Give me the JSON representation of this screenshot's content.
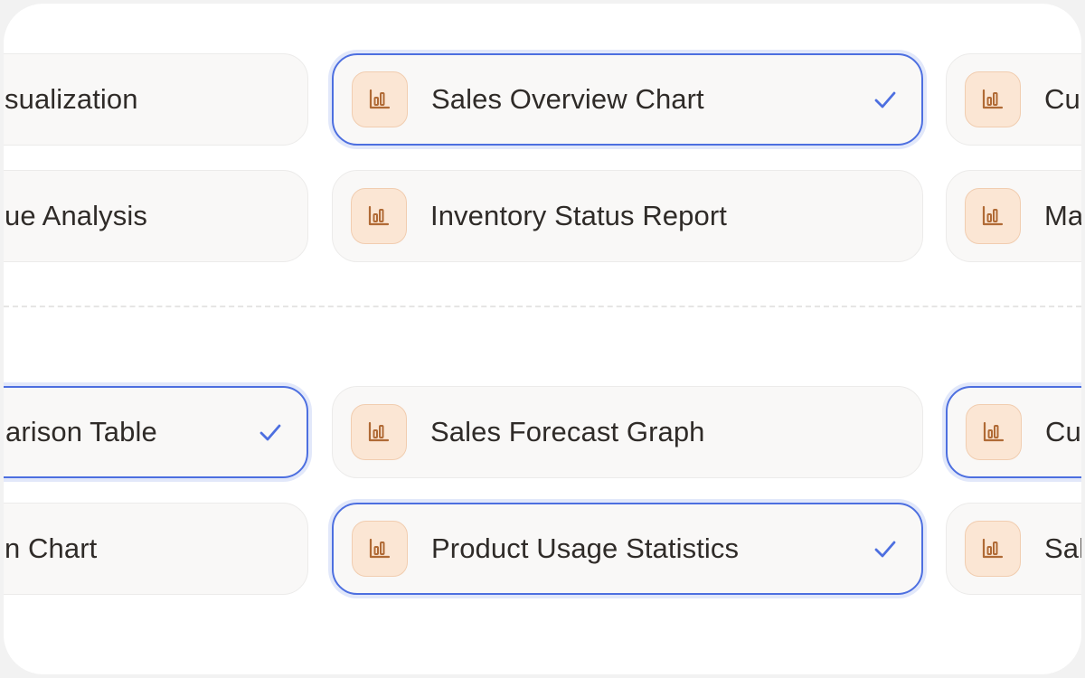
{
  "colors": {
    "accent": "#4d6fe0",
    "icon_bg": "#fbe6d4",
    "icon_stroke": "#b06a35",
    "card_bg": "#f9f8f7",
    "text": "#2f2b28"
  },
  "group1": {
    "row1": {
      "left": {
        "label": "sualization",
        "selected": false
      },
      "middle": {
        "label": "Sales Overview Chart",
        "icon": "bar-chart-icon",
        "selected": true
      },
      "right": {
        "label": "Cu",
        "icon": "bar-chart-icon",
        "selected": false
      }
    },
    "row2": {
      "left": {
        "label": "ue Analysis",
        "selected": false
      },
      "middle": {
        "label": "Inventory Status Report",
        "icon": "bar-chart-icon",
        "selected": false
      },
      "right": {
        "label": "Ma",
        "icon": "bar-chart-icon",
        "selected": false
      }
    }
  },
  "group2": {
    "row1": {
      "left": {
        "label": "arison Table",
        "selected": true
      },
      "middle": {
        "label": "Sales Forecast Graph",
        "icon": "bar-chart-icon",
        "selected": false
      },
      "right": {
        "label": "Cu",
        "icon": "bar-chart-icon",
        "selected": true
      }
    },
    "row2": {
      "left": {
        "label": "n Chart",
        "selected": false
      },
      "middle": {
        "label": "Product Usage Statistics",
        "icon": "bar-chart-icon",
        "selected": true
      },
      "right": {
        "label": "Sal",
        "icon": "bar-chart-icon",
        "selected": false
      }
    }
  }
}
